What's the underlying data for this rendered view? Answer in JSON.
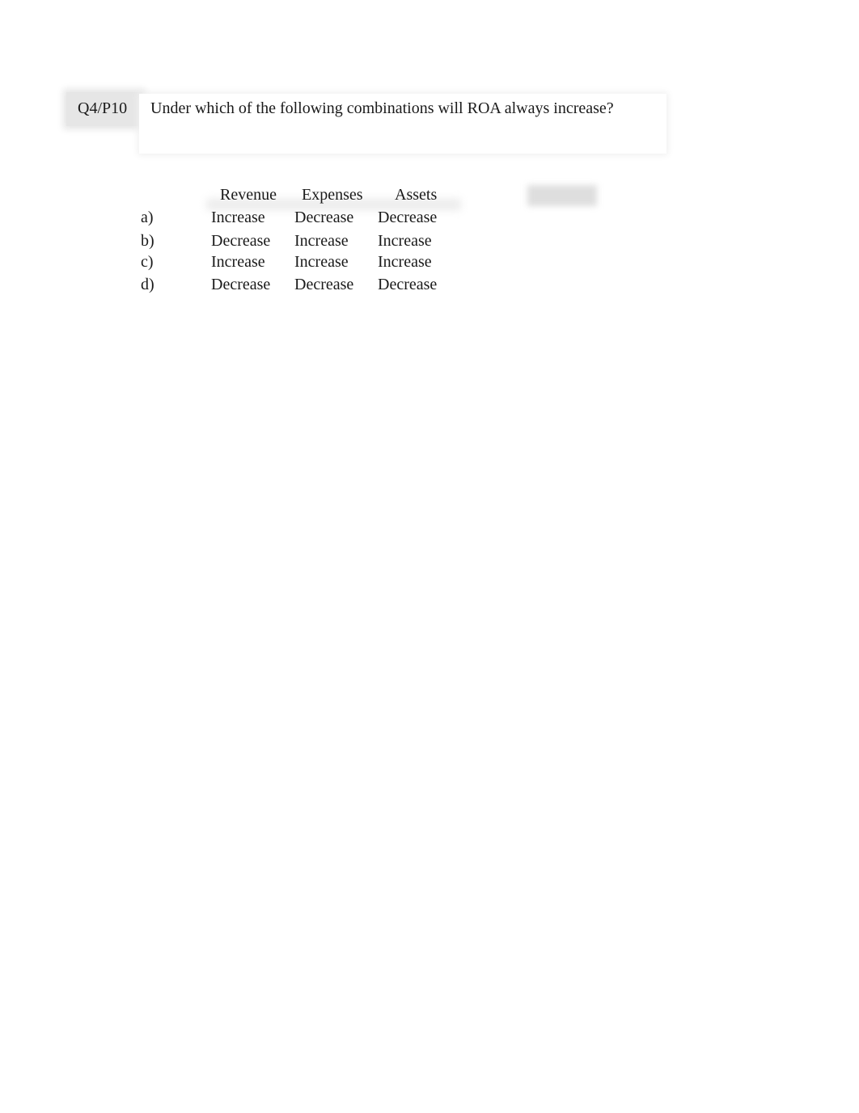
{
  "question": {
    "label": "Q4/P10",
    "text": "Under which of the following combinations will ROA always increase?"
  },
  "table": {
    "headers": [
      "Revenue",
      "Expenses",
      "Assets"
    ],
    "rows": [
      {
        "option": "a)",
        "values": [
          "Increase",
          "Decrease",
          "Decrease"
        ]
      },
      {
        "option": "b)",
        "values": [
          "Decrease",
          "Increase",
          "Increase"
        ]
      },
      {
        "option": "c)",
        "values": [
          "Increase",
          "Increase",
          "Increase"
        ]
      },
      {
        "option": "d)",
        "values": [
          "Decrease",
          "Decrease",
          "Decrease"
        ]
      }
    ]
  }
}
